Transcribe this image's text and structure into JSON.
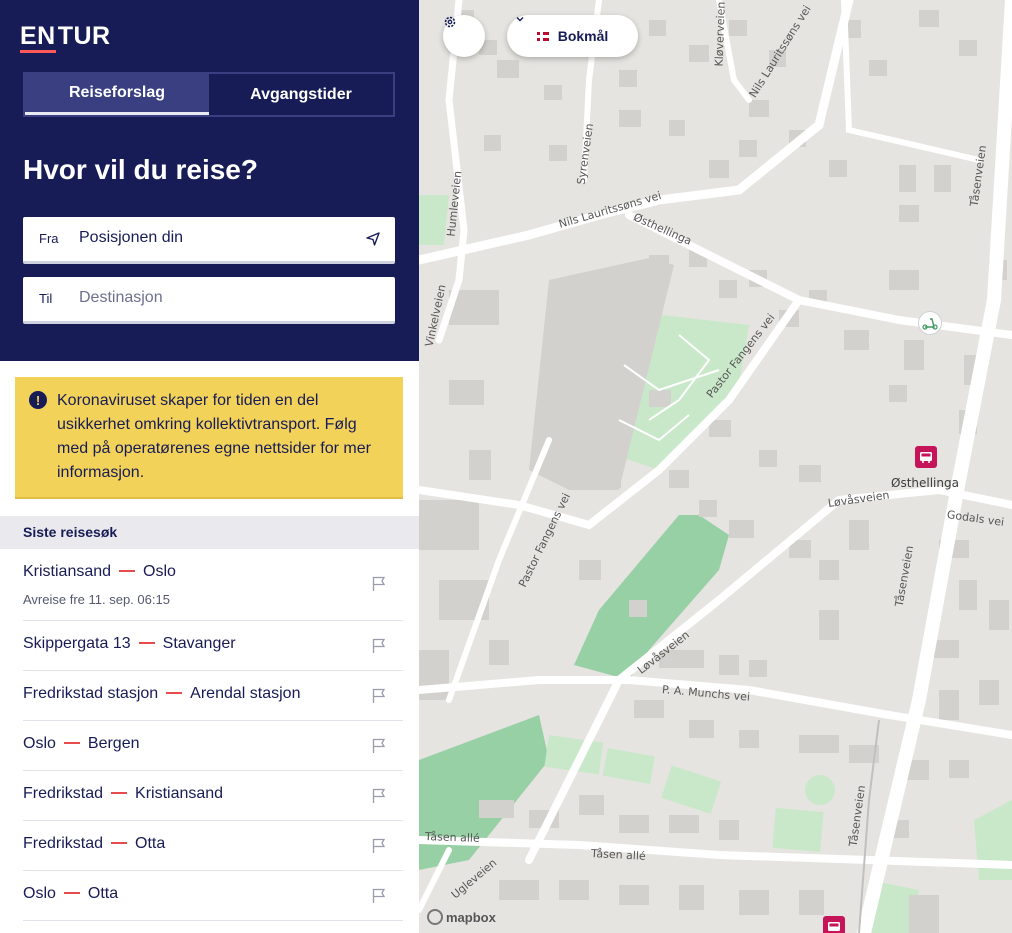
{
  "brand": {
    "logo_part1": "EN",
    "logo_part2": "TUR"
  },
  "tabs": [
    {
      "label": "Reiseforslag",
      "active": true
    },
    {
      "label": "Avgangstider",
      "active": false
    }
  ],
  "search": {
    "heading": "Hvor vil du reise?",
    "from_label": "Fra",
    "from_value": "Posisjonen din",
    "to_label": "Til",
    "to_placeholder": "Destinasjon"
  },
  "notice": {
    "text": "Koronaviruset skaper for tiden en del usikkerhet omkring kollektivtransport. Følg med på operatørenes egne nettsider for mer informasjon."
  },
  "recent": {
    "title": "Siste reisesøk",
    "items": [
      {
        "from": "Kristiansand",
        "to": "Oslo",
        "sub": "Avreise fre 11. sep. 06:15"
      },
      {
        "from": "Skippergata 13",
        "to": "Stavanger"
      },
      {
        "from": "Fredrikstad stasjon",
        "to": "Arendal stasjon"
      },
      {
        "from": "Oslo",
        "to": "Bergen"
      },
      {
        "from": "Fredrikstad",
        "to": "Kristiansand"
      },
      {
        "from": "Fredrikstad",
        "to": "Otta"
      },
      {
        "from": "Oslo",
        "to": "Otta"
      }
    ]
  },
  "map": {
    "language": "Bokmål",
    "stop_name": "Østhellinga",
    "attribution": "mapbox",
    "streets": {
      "s1": "Kløverveien",
      "s2": "Nils Lauritssøns vei",
      "s3": "Syrenveien",
      "s4": "Humleveien",
      "s5": "Nils Lauritssøns vei",
      "s6": "Østhellinga",
      "s7": "Tåsenveien",
      "s8": "Vinkelveien",
      "s9": "Pastor Fangens vei",
      "s10": "Løvåsveien",
      "s11": "Godals vei",
      "s12": "Pastor Fangens vei",
      "s13": "Tåsenveien",
      "s14": "Løvåsveien",
      "s15": "P. A. Munchs vei",
      "s16": "Tåsen allé",
      "s17": "Tåsen allé",
      "s18": "Ugleveien",
      "s19": "Tåsenveien"
    }
  },
  "colors": {
    "brand_navy": "#181c56",
    "notice_yellow": "#f2d259",
    "accent_red": "#e84b4b",
    "stop_magenta": "#c6145b"
  }
}
